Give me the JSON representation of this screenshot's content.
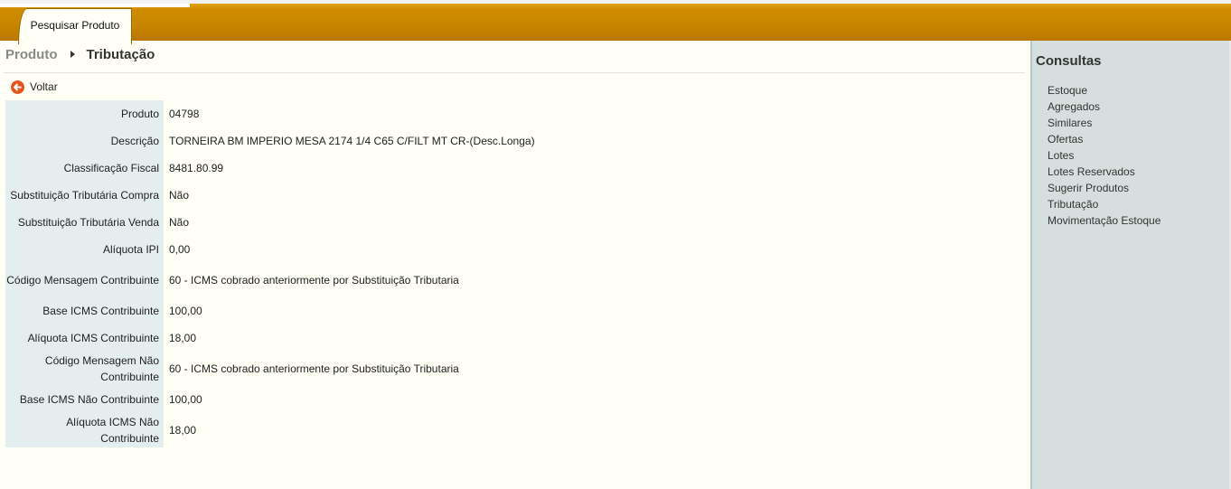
{
  "tab": {
    "label": "Pesquisar Produto"
  },
  "breadcrumb": {
    "parent": "Produto",
    "current": "Tributação"
  },
  "back": {
    "label": "Voltar"
  },
  "fields": [
    {
      "label": "Produto",
      "value": "04798"
    },
    {
      "label": "Descrição",
      "value": "TORNEIRA BM IMPERIO MESA 2174 1/4 C65 C/FILT MT CR-(Desc.Longa)"
    },
    {
      "label": "Classificação Fiscal",
      "value": "8481.80.99"
    },
    {
      "label": "Substituição Tributária Compra",
      "value": "Não"
    },
    {
      "label": "Substituição Tributária Venda",
      "value": "Não"
    },
    {
      "label": "Alíquota IPI",
      "value": "0,00"
    },
    {
      "label": "Código Mensagem Contribuinte",
      "value": "60 - ICMS cobrado anteriormente por Substituição Tributaria"
    },
    {
      "label": "Base ICMS Contribuinte",
      "value": "100,00"
    },
    {
      "label": "Alíquota ICMS Contribuinte",
      "value": "18,00"
    },
    {
      "label": "Código Mensagem Não Contribuinte",
      "value": "60 - ICMS cobrado anteriormente por Substituição Tributaria"
    },
    {
      "label": "Base ICMS Não Contribuinte",
      "value": "100,00"
    },
    {
      "label": "Alíquota ICMS Não Contribuinte",
      "value": "18,00"
    }
  ],
  "sidebar": {
    "title": "Consultas",
    "items": [
      {
        "label": "Estoque"
      },
      {
        "label": "Agregados"
      },
      {
        "label": "Similares"
      },
      {
        "label": "Ofertas"
      },
      {
        "label": "Lotes"
      },
      {
        "label": "Lotes Reservados"
      },
      {
        "label": "Sugerir Produtos"
      },
      {
        "label": "Tributação"
      },
      {
        "label": "Movimentação Estoque"
      }
    ]
  },
  "colors": {
    "accent": "#c88700",
    "back_icon": "#e5541b",
    "label_bg": "#e4eeee",
    "sidebar_bg": "#d5e0de"
  },
  "icons": {
    "back": "arrow-left-circle-icon",
    "breadcrumb_separator": "triangle-right-icon"
  }
}
